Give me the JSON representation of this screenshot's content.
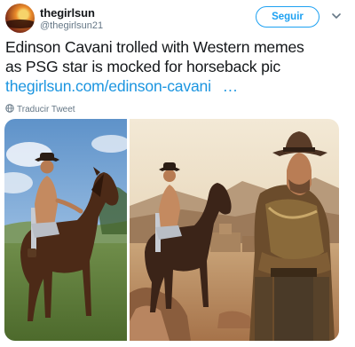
{
  "author": {
    "display_name": "thegirlsun",
    "handle": "@thegirlsun21",
    "avatar_icon": "sunset-avatar"
  },
  "follow_label": "Seguir",
  "menu_icon": "chevron-down-icon",
  "tweet": {
    "line1": "Edinson Cavani trolled with Western memes",
    "line2": "as PSG star is mocked for horseback pic",
    "link_text": "thegirlsun.com/edinson-cavani",
    "ellipsis": "…"
  },
  "translate_label": "Traducir Tweet",
  "translate_icon": "globe-icon",
  "colors": {
    "accent": "#1da1f2",
    "link": "#1b95e0",
    "secondary_text": "#657786"
  },
  "media": {
    "left_photo_icon": "man-on-horse-photo",
    "right_photo_icon": "western-meme-photo"
  }
}
